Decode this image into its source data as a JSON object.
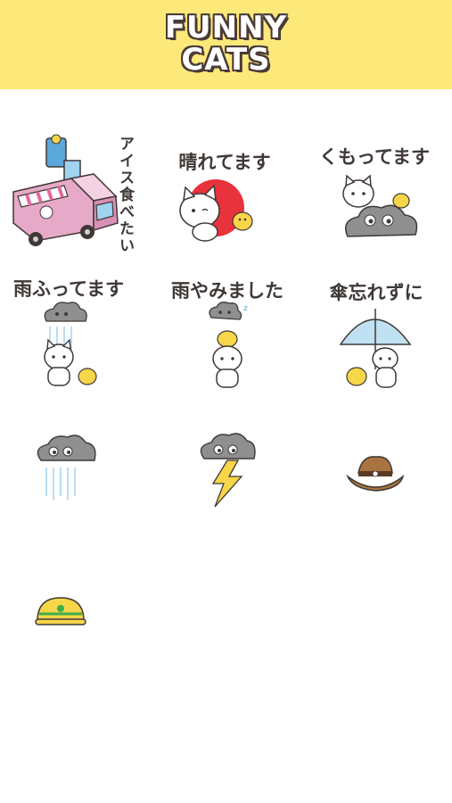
{
  "app": {
    "logo_line1": "FUNNY",
    "logo_line2": "CATS"
  },
  "stickers": [
    {
      "caption": "アイス食べたい",
      "art": "ice-cream-truck"
    },
    {
      "caption": "晴れてます",
      "art": "sunny-cat"
    },
    {
      "caption": "くもってます",
      "art": "cloudy-cat"
    },
    {
      "caption": "雨ふってます",
      "art": "rainy-cat"
    },
    {
      "caption": "雨やみました",
      "art": "rain-stopped-cat"
    },
    {
      "caption": "傘忘れずに",
      "art": "umbrella-cat"
    },
    {
      "caption": "",
      "art": "rain-cloud"
    },
    {
      "caption": "",
      "art": "thunder-cloud"
    },
    {
      "caption": "",
      "art": "cowboy-hat"
    },
    {
      "caption": "",
      "art": "helmet"
    }
  ],
  "colors": {
    "header": "#fde97a",
    "text": "#3f3836",
    "sun": "#e8323c",
    "cloud": "#8f8f8f",
    "chick": "#f7d64a"
  }
}
